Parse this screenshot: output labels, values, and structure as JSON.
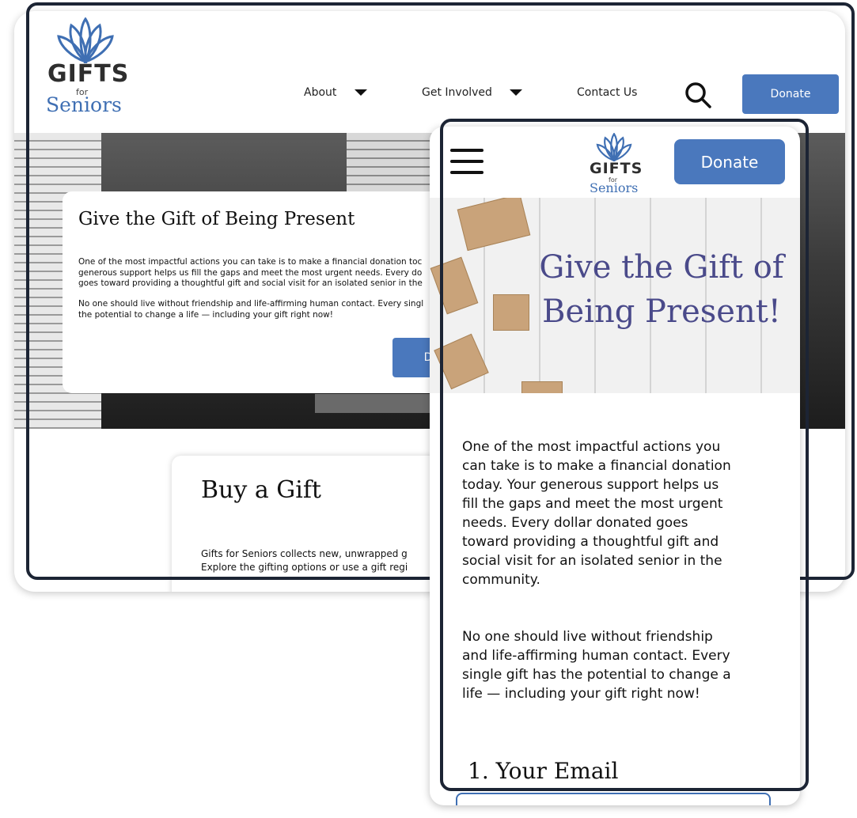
{
  "brand": {
    "gifts": "GIFTS",
    "for": "for",
    "seniors": "Seniors",
    "color": "#3f6fb3"
  },
  "desktop": {
    "nav": {
      "about": "About",
      "get_involved": "Get Involved",
      "contact": "Contact Us"
    },
    "donate_label": "Donate",
    "hero": {
      "title": "Give the Gift of Being Present",
      "p1": "One of the most impactful actions you can take is to make a financial donation toc\ngenerous support helps us fill the gaps and meet the most urgent needs.  Every do\ngoes toward providing a thoughtful gift and social visit for an isolated senior in the",
      "p2": "No one should live without friendship and life-affirming human contact. Every singl\nthe potential to change a life — including your gift right now!",
      "donate_partial": "D"
    },
    "gift_card": {
      "title": "Buy a Gift",
      "text": "Gifts for Seniors collects new, unwrapped g\nExplore the gifting options or use a gift regi"
    }
  },
  "mobile": {
    "donate_label": "Donate",
    "hero_title": "Give the Gift of Being Present!",
    "p1": "One of the most impactful actions you\ncan take is to make a financial donation\ntoday. Your generous support helps us\nfill the gaps and meet the most urgent\nneeds.  Every dollar donated goes\ntoward providing a thoughtful gift and\nsocial visit for an isolated senior in the\ncommunity.",
    "p2": "No one should live without friendship\nand life-affirming human contact. Every\nsingle gift has the potential to change a\nlife — including your gift right now!",
    "email_heading": "1. Your Email"
  },
  "colors": {
    "accent": "#4a78bd",
    "frame": "#1c2434",
    "hero_title": "#4a4a8a"
  },
  "icons": [
    "flower-logo-icon",
    "caret-down-icon",
    "search-icon",
    "hamburger-menu-icon"
  ]
}
